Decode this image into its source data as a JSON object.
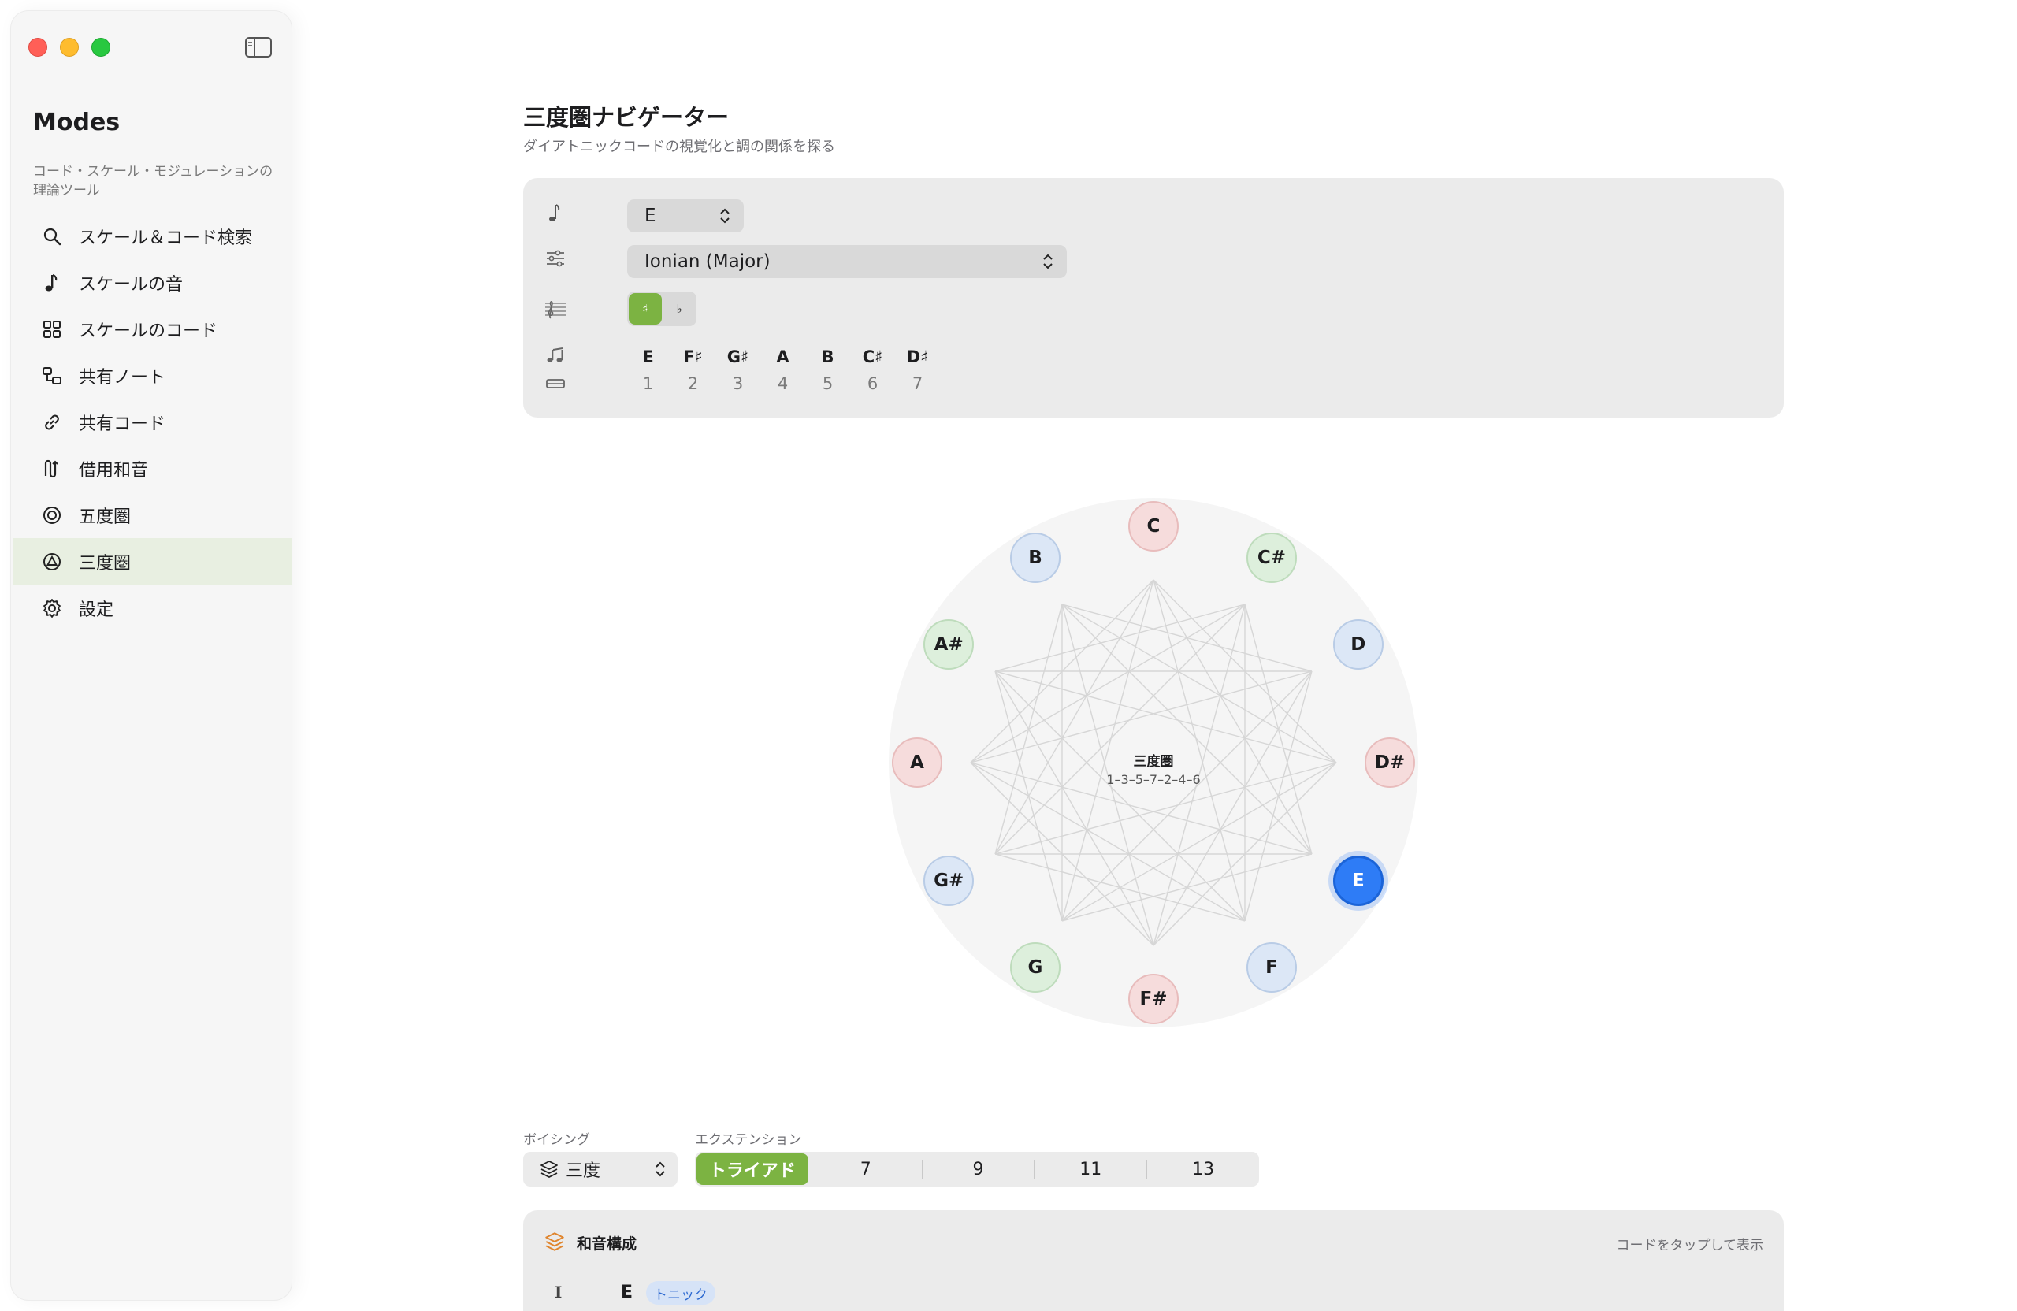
{
  "app": {
    "title": "Modes",
    "subtitle": "コード・スケール・モジュレーションの理論ツール"
  },
  "sidebar": {
    "items": [
      {
        "label": "スケール＆コード検索",
        "icon": "search-icon"
      },
      {
        "label": "スケールの音",
        "icon": "music-note-icon"
      },
      {
        "label": "スケールのコード",
        "icon": "grid-icon"
      },
      {
        "label": "共有ノート",
        "icon": "shared-notes-icon"
      },
      {
        "label": "共有コード",
        "icon": "link-icon"
      },
      {
        "label": "借用和音",
        "icon": "borrowed-chord-icon"
      },
      {
        "label": "五度圏",
        "icon": "circle-icon"
      },
      {
        "label": "三度圏",
        "icon": "triangle-circle-icon",
        "active": true
      },
      {
        "label": "設定",
        "icon": "gear-icon"
      }
    ]
  },
  "main": {
    "title": "三度圏ナビゲーター",
    "subtitle": "ダイアトニックコードの視覚化と調の関係を探る",
    "key_select": "E",
    "mode_select": "Ionian (Major)",
    "accidentals": {
      "sharp": "♯",
      "flat": "♭",
      "selected": "sharp"
    },
    "scale_notes": [
      "E",
      "F♯",
      "G♯",
      "A",
      "B",
      "C♯",
      "D♯"
    ],
    "scale_degrees": [
      "1",
      "2",
      "3",
      "4",
      "5",
      "6",
      "7"
    ]
  },
  "circle": {
    "center_title": "三度圏",
    "center_sequence": "1–3–5–7–2–4–6",
    "nodes": [
      {
        "label": "C",
        "color": "red"
      },
      {
        "label": "C#",
        "color": "green"
      },
      {
        "label": "D",
        "color": "blue"
      },
      {
        "label": "D#",
        "color": "red"
      },
      {
        "label": "E",
        "color": "selected"
      },
      {
        "label": "F",
        "color": "blue"
      },
      {
        "label": "F#",
        "color": "red"
      },
      {
        "label": "G",
        "color": "green"
      },
      {
        "label": "G#",
        "color": "blue"
      },
      {
        "label": "A",
        "color": "red"
      },
      {
        "label": "A#",
        "color": "green"
      },
      {
        "label": "B",
        "color": "blue"
      }
    ],
    "selected_note": "E"
  },
  "controls": {
    "voicing_label": "ボイシング",
    "voicing_value": "三度",
    "extension_label": "エクステンション",
    "extensions": [
      "トライアド",
      "7",
      "9",
      "11",
      "13"
    ],
    "extension_selected": "トライアド"
  },
  "chord_card": {
    "title": "和音構成",
    "hint": "コードをタップして表示",
    "rows": [
      {
        "roman": "I",
        "root": "E",
        "badge": "トニック"
      }
    ]
  },
  "colors": {
    "accent_green": "#7cb342",
    "selected_blue": "#2e7cf6"
  }
}
